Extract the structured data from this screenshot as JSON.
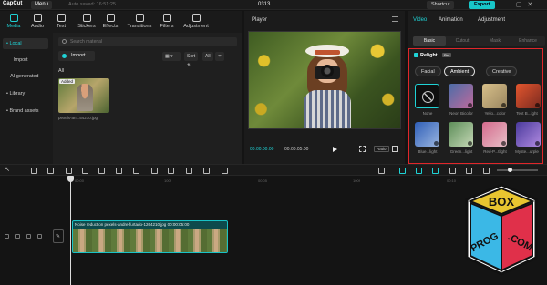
{
  "app": {
    "logo": "CapCut",
    "menu_label": "Menu",
    "autosave": "Auto saved: 16:51:25",
    "project_name": "0313",
    "shortcut_label": "Shortcut",
    "export_label": "Export"
  },
  "tools": {
    "tabs": [
      {
        "label": "Media",
        "icon": "media-icon",
        "active": true
      },
      {
        "label": "Audio",
        "icon": "audio-icon"
      },
      {
        "label": "Text",
        "icon": "text-icon"
      },
      {
        "label": "Stickers",
        "icon": "stickers-icon"
      },
      {
        "label": "Effects",
        "icon": "effects-icon"
      },
      {
        "label": "Transitions",
        "icon": "transitions-icon"
      },
      {
        "label": "Filters",
        "icon": "filters-icon"
      },
      {
        "label": "Adjustment",
        "icon": "adjustment-icon"
      }
    ]
  },
  "sidenav": {
    "items": [
      {
        "label": "• Local",
        "active": true
      },
      {
        "label": "Import"
      },
      {
        "label": "AI generated"
      },
      {
        "label": "• Library"
      },
      {
        "label": "• Brand assets"
      }
    ]
  },
  "media": {
    "search_placeholder": "Search material",
    "import_label": "Import",
    "sort_label": "Sort",
    "all_filter": "All",
    "all_heading": "All",
    "thumb_badge": "Added",
    "thumb_name": "pexels-an...54210.jpg"
  },
  "player": {
    "title": "Player",
    "time_current": "00:00:00:00",
    "time_total": "00:00:05:00",
    "ratio_label": "Ratio"
  },
  "right_panel": {
    "tabs": [
      {
        "label": "Video",
        "active": true
      },
      {
        "label": "Animation"
      },
      {
        "label": "Adjustment"
      }
    ],
    "subtabs": [
      {
        "label": "Basic",
        "active": true
      },
      {
        "label": "Cutout"
      },
      {
        "label": "Mask"
      },
      {
        "label": "Enhance"
      }
    ],
    "relight": {
      "title": "Relight",
      "badge": "Pro",
      "modes": [
        {
          "label": "Facial"
        },
        {
          "label": "Ambient",
          "active": true
        },
        {
          "label": "Creative"
        }
      ],
      "presets": [
        {
          "label": "None",
          "color": "#0f0f0f"
        },
        {
          "label": "Neon Bicolor",
          "color": "#b35a8a"
        },
        {
          "label": "Yello...color",
          "color": "#c2a35a"
        },
        {
          "label": "Text B...ight",
          "color": "#d0472c"
        },
        {
          "label": "Blue...light",
          "color": "#3d73c9"
        },
        {
          "label": "Green...light",
          "color": "#6f9a6a"
        },
        {
          "label": "Red-P...tlight",
          "color": "#c26a8a"
        },
        {
          "label": "Myste...urple",
          "color": "#6a4cb0"
        }
      ]
    }
  },
  "timeline": {
    "ruler": [
      "00:00",
      "100f",
      "00:05",
      "100f",
      "00:10"
    ],
    "clip_label": "Noise reduction  pexels-andre-furtado-1264210.jpg  00:00:05:00",
    "cover_label": ""
  },
  "watermark": {
    "top": "BOX",
    "bottom": "PROG",
    "side": ".COM"
  },
  "colors": {
    "accent": "#1fd3d6",
    "highlight": "#e0262a",
    "export": "#18c6c8"
  }
}
